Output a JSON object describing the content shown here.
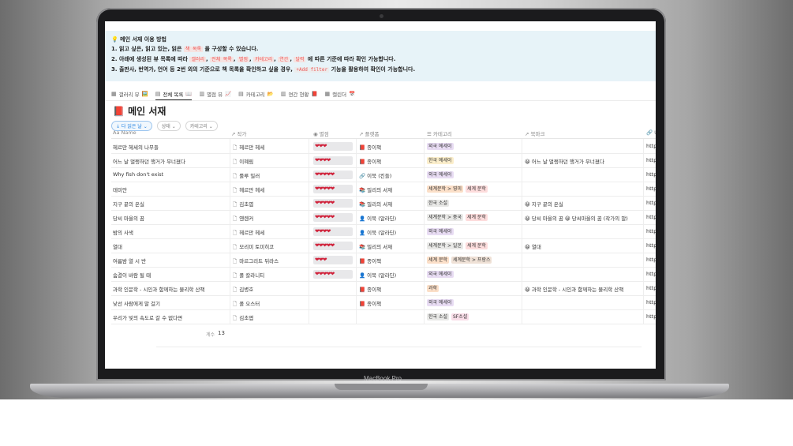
{
  "device": {
    "label": "MacBook Pro"
  },
  "callout": {
    "title_icon": "bulb-icon",
    "title": "메인 서재 이용 방법",
    "line1_a": "1. 읽고 싶은, 읽고 있는, 읽은",
    "line1_chip": "책 목록",
    "line1_b": "을 구성할 수 있습니다.",
    "line2_a": "2. 아래에 생성된 뷰 목록에 따라",
    "line2_chips": [
      "갤러리",
      "전체 목록",
      "별점",
      "카테고리",
      "연간",
      "달력"
    ],
    "line2_b": "에 따른 기준에 따라 확인 가능합니다.",
    "line3_a": "3. 출판사, 번역가, 언어 등 2번 외의 기준으로 책 목록을 확인하고 싶을 경우,",
    "line3_chip": "+Add filter",
    "line3_b": "기능을 활용하여 확인이 가능합니다."
  },
  "tabs": [
    {
      "label": "갤러리 뷰",
      "emoji": "🖼️"
    },
    {
      "label": "전체 목록",
      "emoji": "📖"
    },
    {
      "label": "별점 뷰",
      "emoji": "📈"
    },
    {
      "label": "카테고리",
      "emoji": "📂"
    },
    {
      "label": "연간 현황",
      "emoji": "📕"
    },
    {
      "label": "캘린더",
      "emoji": "📅"
    }
  ],
  "db_title": "📕 메인 서재",
  "filters": {
    "sort": "↓ 다 읽은 날 ⌄",
    "status": "상태 ⌄",
    "category": "카테고리 ⌄"
  },
  "columns": [
    "Aa Name",
    "작가",
    "별점",
    "플랫폼",
    "카테고리",
    "북마크",
    "U"
  ],
  "rows": [
    {
      "name": "헤르만 헤세의 나무들",
      "author": "헤르만 헤세",
      "stars": "❤❤❤",
      "platform_icon": "📕",
      "platform": "종이책",
      "tags": [
        {
          "t": "외국 에세이",
          "c": "purple"
        }
      ],
      "bookmark": "",
      "url": "http"
    },
    {
      "name": "어느 날 멀쩡하던 행거가 무너졌다",
      "author": "이혜림",
      "stars": "❤❤❤❤",
      "platform_icon": "📕",
      "platform": "종이책",
      "tags": [
        {
          "t": "한국 에세이",
          "c": "yellow"
        }
      ],
      "bookmark": "😀 어느 날 멀쩡하던 행거가 무너졌다",
      "url": "http"
    },
    {
      "name": "Why fish don't exist",
      "author": "룰루 밀러",
      "stars": "❤❤❤❤❤",
      "platform_icon": "🔗",
      "platform": "이북 (킨들)",
      "tags": [
        {
          "t": "외국 에세이",
          "c": "purple"
        }
      ],
      "bookmark": "",
      "url": "http"
    },
    {
      "name": "데미안",
      "author": "헤르만 헤세",
      "stars": "❤❤❤❤❤",
      "platform_icon": "📚",
      "platform": "밀리의 서재",
      "tags": [
        {
          "t": "세계문학 > 영미",
          "c": "orange"
        },
        {
          "t": "세계 문학",
          "c": "red"
        }
      ],
      "bookmark": "",
      "url": "http"
    },
    {
      "name": "지구 끝의 온실",
      "author": "김초엽",
      "stars": "❤❤❤❤❤",
      "platform_icon": "📚",
      "platform": "밀리의 서재",
      "tags": [
        {
          "t": "한국 소설",
          "c": "gray"
        }
      ],
      "bookmark": "😀 지구 끝의 온실",
      "url": "http"
    },
    {
      "name": "당씨 마을의 꿈",
      "author": "옌롄커",
      "stars": "❤❤❤❤❤",
      "platform_icon": "👤",
      "platform": "이북 (알라딘)",
      "tags": [
        {
          "t": "세계문학 > 중국",
          "c": "gray"
        },
        {
          "t": "세계 문학",
          "c": "red"
        }
      ],
      "bookmark": "😀 당씨 마을의 꿈   😀 당씨마을의 꿈 (작가의 말)",
      "url": "http"
    },
    {
      "name": "밤의 사색",
      "author": "헤르만 헤세",
      "stars": "❤❤❤❤",
      "platform_icon": "👤",
      "platform": "이북 (알라딘)",
      "tags": [
        {
          "t": "외국 에세이",
          "c": "purple"
        }
      ],
      "bookmark": "",
      "url": "http"
    },
    {
      "name": "열대",
      "author": "모리미 토미히코",
      "stars": "❤❤❤❤❤",
      "platform_icon": "📚",
      "platform": "밀리의 서재",
      "tags": [
        {
          "t": "세계문학 > 일본",
          "c": "gray"
        },
        {
          "t": "세계 문학",
          "c": "red"
        }
      ],
      "bookmark": "😀 열대",
      "url": "http"
    },
    {
      "name": "여름밤 열 시 반",
      "author": "마르그리트 뒤라스",
      "stars": "❤❤❤",
      "platform_icon": "📕",
      "platform": "종이책",
      "tags": [
        {
          "t": "세계 문학",
          "c": "orange"
        },
        {
          "t": "세계문학 > 프랑스",
          "c": "brown"
        }
      ],
      "bookmark": "",
      "url": "http"
    },
    {
      "name": "숨결이 바람 될 때",
      "author": "폴 칼라니티",
      "stars": "❤❤❤❤❤",
      "platform_icon": "👤",
      "platform": "이북 (알라딘)",
      "tags": [
        {
          "t": "외국 에세이",
          "c": "purple"
        }
      ],
      "bookmark": "",
      "url": "http"
    },
    {
      "name": "과학 인문학 - 시인과 함께하는 물리학 산책",
      "author": "김병호",
      "stars": "",
      "platform_icon": "📕",
      "platform": "종이책",
      "tags": [
        {
          "t": "과학",
          "c": "orange"
        }
      ],
      "bookmark": "😀 과학 인문학 - 시인과 함께하는 물리학 산책",
      "url": "http"
    },
    {
      "name": "낯선 사람에게 말 걸기",
      "author": "폴 오스터",
      "stars": "",
      "platform_icon": "📕",
      "platform": "종이책",
      "tags": [
        {
          "t": "외국 에세이",
          "c": "purple"
        }
      ],
      "bookmark": "",
      "url": "http"
    },
    {
      "name": "우리가 빛의 속도로 갈 수 없다면",
      "author": "김초엽",
      "stars": "",
      "platform_icon": "",
      "platform": "",
      "tags": [
        {
          "t": "한국 소설",
          "c": "gray"
        },
        {
          "t": "SF소설",
          "c": "pink"
        }
      ],
      "bookmark": "",
      "url": "http"
    }
  ],
  "footer": {
    "count_label": "계수",
    "count_value": "13"
  }
}
